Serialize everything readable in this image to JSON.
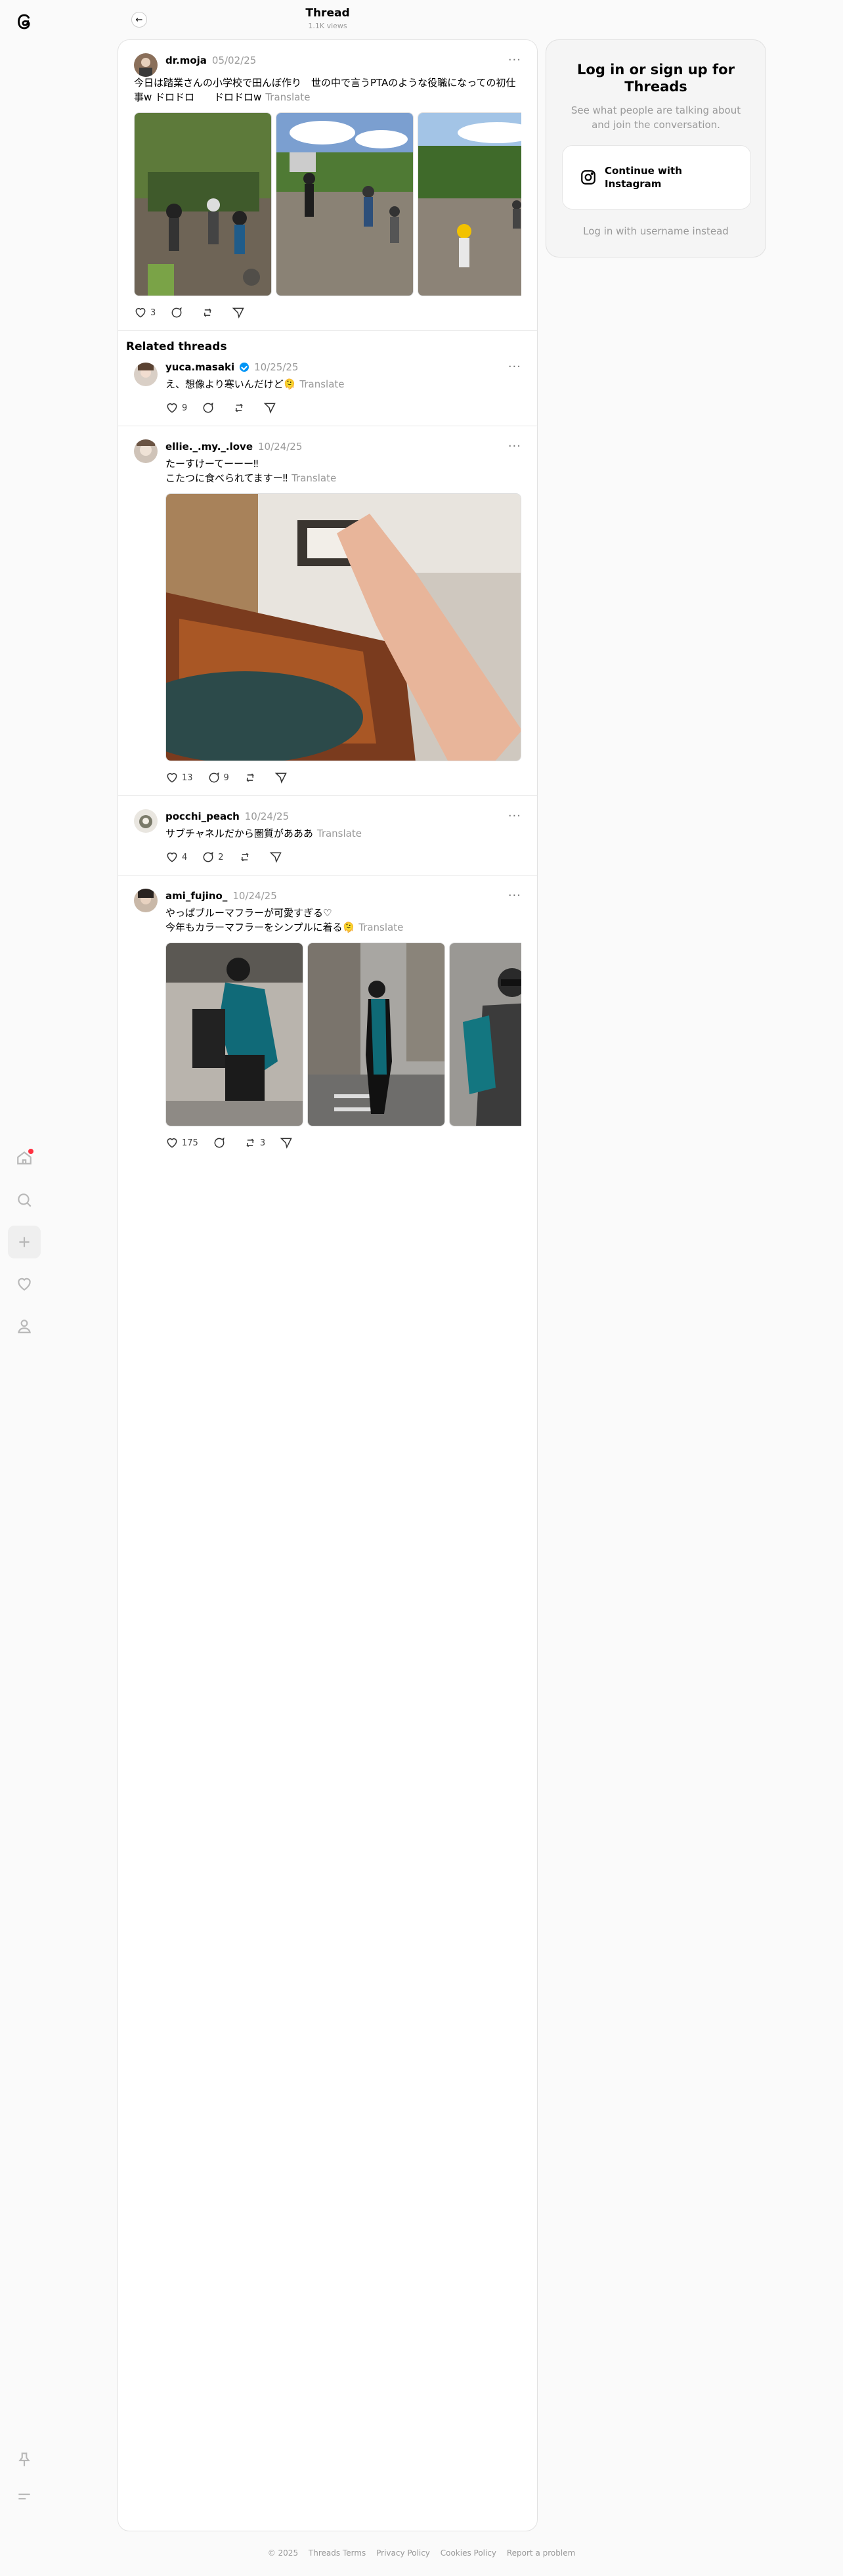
{
  "header": {
    "title": "Thread",
    "subtitle": "1.1K views"
  },
  "main_post": {
    "username": "dr.moja",
    "date": "05/02/25",
    "text": "今日は踏業さんの小学校で田んぼ作り　世の中で言うPTAのような役職になっての初仕事w ドロドロ　　ドロドロw",
    "translate": "Translate",
    "likes": "3",
    "replies": "",
    "reposts": ""
  },
  "related_title": "Related threads",
  "threads": [
    {
      "username": "yuca.masaki",
      "verified": true,
      "date": "10/25/25",
      "text": "え、想像より寒いんだけど🫠",
      "translate": "Translate",
      "likes": "9",
      "replies": "",
      "reposts": ""
    },
    {
      "username": "ellie._.my._.love",
      "verified": false,
      "date": "10/24/25",
      "text": "たーすけーてーーー‼︎\nこたつに食べられてますー‼︎",
      "translate": "Translate",
      "likes": "13",
      "replies": "9",
      "reposts": ""
    },
    {
      "username": "pocchi_peach",
      "verified": false,
      "date": "10/24/25",
      "text": "サブチャネルだから圏質があああ",
      "translate": "Translate",
      "likes": "4",
      "replies": "2",
      "reposts": ""
    },
    {
      "username": "ami_fujino_",
      "verified": false,
      "date": "10/24/25",
      "text": "やっぱブルーマフラーが可愛すぎる♡\n今年もカラーマフラーをシンプルに着る🫠",
      "translate": "Translate",
      "likes": "175",
      "replies": "",
      "reposts": "3"
    }
  ],
  "login_card": {
    "title": "Log in or sign up for Threads",
    "subtitle": "See what people are talking about and join the conversation.",
    "button": "Continue with Instagram",
    "alt_link": "Log in with username instead"
  },
  "footer": [
    "© 2025",
    "Threads Terms",
    "Privacy Policy",
    "Cookies Policy",
    "Report a problem"
  ],
  "icons": {
    "rail": [
      "threads-logo-icon",
      "home-icon",
      "search-icon",
      "create-icon",
      "heart-icon",
      "profile-icon",
      "pin-icon",
      "menu-icon"
    ],
    "notification_dot_color": "#ff3040",
    "verified_color": "#0095f6"
  }
}
